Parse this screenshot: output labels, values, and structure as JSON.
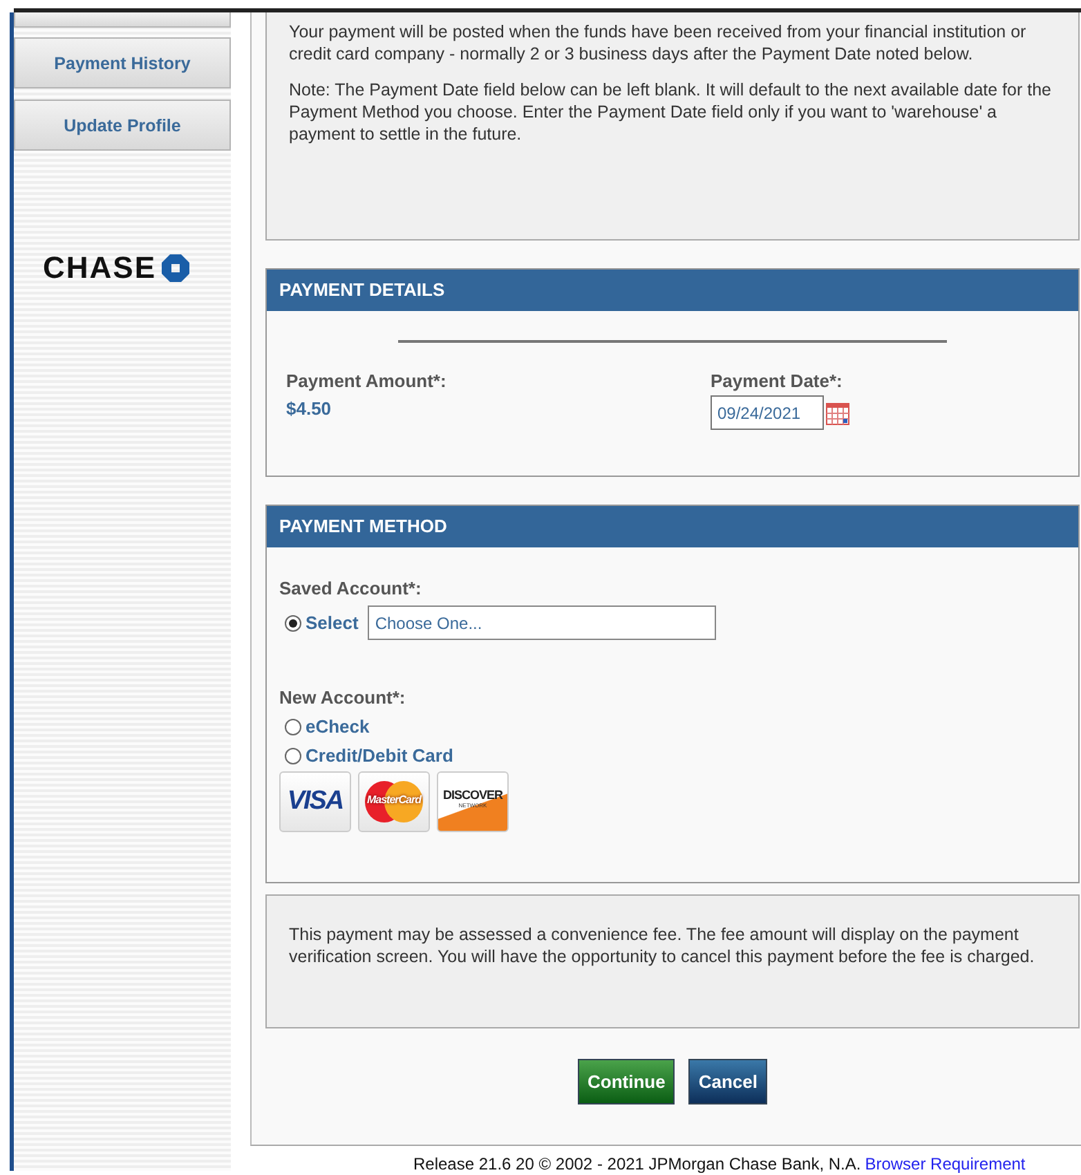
{
  "sidebar": {
    "items": [
      {
        "label": "Payment History"
      },
      {
        "label": "Update Profile"
      }
    ],
    "logo": "CHASE"
  },
  "notice": {
    "paragraphs": [
      "Your payment will be posted when the funds have been received from your financial institution or credit card company - normally 2 or 3 business days after the Payment Date noted below.",
      "Note: The Payment Date field below can be left blank. It will default to the next available date for the Payment Method you choose. Enter the Payment Date field only if you want to 'warehouse' a payment to settle in the future."
    ]
  },
  "payment_details": {
    "title": "PAYMENT DETAILS",
    "amount_label": "Payment Amount*:",
    "amount": "$4.50",
    "date_label": "Payment Date*:",
    "date_value": "09/24/2021"
  },
  "payment_method": {
    "title": "PAYMENT METHOD",
    "saved_label": "Saved Account*:",
    "saved_options": [
      {
        "label": "Select",
        "selected": true,
        "value": "Choose One..."
      }
    ],
    "new_label": "New Account*:",
    "new_options": [
      {
        "label": "eCheck",
        "selected": false
      },
      {
        "label": "Credit/Debit Card",
        "selected": false
      }
    ],
    "cards": [
      {
        "kind": "visa",
        "text": "VISA"
      },
      {
        "kind": "mastercard",
        "text": "MasterCard"
      },
      {
        "kind": "discover",
        "text": "DISCOVER",
        "subtext": "NETWORK"
      }
    ]
  },
  "fee_notice": "This payment may be assessed a convenience fee. The fee amount will display on the payment verification screen. You will have the opportunity to cancel this payment before the fee is charged.",
  "buttons": [
    {
      "kind": "primary",
      "label": "Continue"
    },
    {
      "kind": "secondary",
      "label": "Cancel"
    }
  ],
  "footer": {
    "text": "Release 21.6 20 © 2002 - 2021 JPMorgan Chase Bank, N.A.",
    "link": "Browser Requirement"
  }
}
